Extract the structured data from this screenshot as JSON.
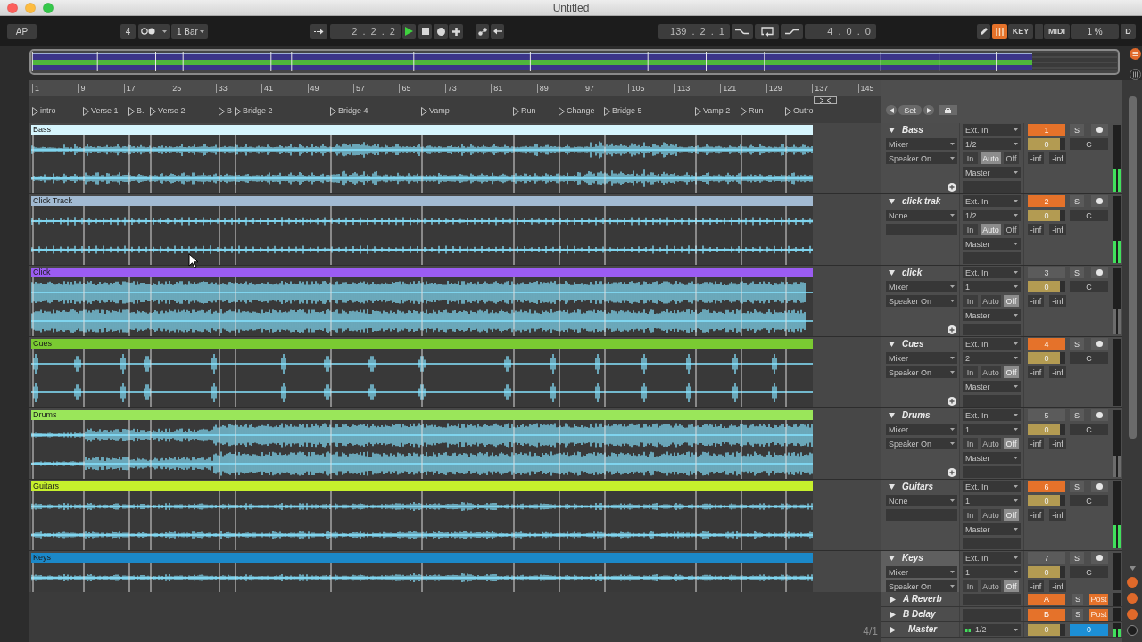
{
  "window": {
    "title": "Untitled"
  },
  "control_bar": {
    "tap": "AP",
    "signature": "4",
    "quantization": "1 Bar",
    "position": "2 . 2 . 2",
    "playing": true,
    "loop_start": "139 . 2 . 1",
    "loop_length": "4 . 0 . 0",
    "computer_keyboard": {
      "on": true
    },
    "key_map": "KEY",
    "midi_map": "MIDI",
    "cpu_load": "1 %",
    "disk_overload": "D"
  },
  "ruler": {
    "bars": [
      "1",
      "9",
      "17",
      "25",
      "33",
      "41",
      "49",
      "57",
      "65",
      "73",
      "81",
      "89",
      "97",
      "105",
      "113",
      "121",
      "129",
      "137",
      "145"
    ]
  },
  "locators": [
    "intro",
    "Verse 1",
    "B.",
    "Verse 2",
    "B",
    "Bridge 2",
    "Bridge 4",
    "Vamp",
    "Run",
    "Change",
    "Bridge 5",
    "Vamp 2",
    "Run",
    "Outro"
  ],
  "set_button": "Set",
  "tracks": [
    {
      "name": "Bass",
      "expanded": true,
      "selected": false,
      "clip": {
        "name": "Bass",
        "color": "#d6f5fd",
        "kind": "steady"
      },
      "routing": "Mixer",
      "routing_option": "Speaker On",
      "add_button": true,
      "input": "Ext. In",
      "input_channel": "1/2",
      "monitor": [
        {
          "label": "In",
          "selected": false
        },
        {
          "label": "Auto",
          "selected": true
        },
        {
          "label": "Off",
          "selected": false
        }
      ],
      "output": "Master",
      "number": "1",
      "active": true,
      "solo": "S",
      "volume": {
        "value": "0",
        "level": 0.85
      },
      "pan": "C",
      "peaks": [
        "-inf",
        "-inf"
      ],
      "meter": {
        "level": 0.33,
        "lit": true
      }
    },
    {
      "name": "click trak",
      "expanded": true,
      "selected": false,
      "clip": {
        "name": "Click Track",
        "color": "#a2bad2",
        "kind": "pulse"
      },
      "routing": "None",
      "add_button": false,
      "input": "Ext. In",
      "input_channel": "1/2",
      "monitor": [
        {
          "label": "In",
          "selected": false
        },
        {
          "label": "Auto",
          "selected": true
        },
        {
          "label": "Off",
          "selected": false
        }
      ],
      "output": "Master",
      "number": "2",
      "active": true,
      "solo": "S",
      "volume": {
        "value": "0",
        "level": 0.85
      },
      "pan": "C",
      "peaks": [
        "-inf",
        "-inf"
      ],
      "meter": {
        "level": 0.33,
        "lit": true
      }
    },
    {
      "name": "click",
      "expanded": true,
      "selected": false,
      "clip": {
        "name": "Click",
        "color": "#9b5cf2",
        "kind": "dense"
      },
      "routing": "Mixer",
      "routing_option": "Speaker On",
      "add_button": true,
      "input": "Ext. In",
      "input_channel": "1",
      "monitor": [
        {
          "label": "In",
          "selected": false
        },
        {
          "label": "Auto",
          "selected": false
        },
        {
          "label": "Off",
          "selected": true
        }
      ],
      "output": "Master",
      "number": "3",
      "active": false,
      "solo": "S",
      "volume": {
        "value": "0",
        "level": 0.85
      },
      "pan": "C",
      "peaks": [
        "-inf",
        "-inf"
      ],
      "meter": {
        "level": 0.38,
        "lit": false
      }
    },
    {
      "name": "Cues",
      "expanded": true,
      "selected": false,
      "clip": {
        "name": "Cues",
        "color": "#7aca32",
        "kind": "sparse"
      },
      "routing": "Mixer",
      "routing_option": "Speaker On",
      "add_button": true,
      "input": "Ext. In",
      "input_channel": "2",
      "monitor": [
        {
          "label": "In",
          "selected": false
        },
        {
          "label": "Auto",
          "selected": false
        },
        {
          "label": "Off",
          "selected": true
        }
      ],
      "output": "Master",
      "number": "4",
      "active": true,
      "solo": "S",
      "volume": {
        "value": "0",
        "level": 0.85
      },
      "pan": "C",
      "peaks": [
        "-inf",
        "-inf"
      ],
      "meter": {
        "level": 0
      }
    },
    {
      "name": "Drums",
      "expanded": true,
      "selected": false,
      "clip": {
        "name": "Drums",
        "color": "#9ae65a",
        "kind": "build"
      },
      "routing": "Mixer",
      "routing_option": "Speaker On",
      "add_button": true,
      "input": "Ext. In",
      "input_channel": "1",
      "monitor": [
        {
          "label": "In",
          "selected": false
        },
        {
          "label": "Auto",
          "selected": false
        },
        {
          "label": "Off",
          "selected": true
        }
      ],
      "output": "Master",
      "number": "5",
      "active": false,
      "solo": "S",
      "volume": {
        "value": "0",
        "level": 0.85
      },
      "pan": "C",
      "peaks": [
        "-inf",
        "-inf"
      ],
      "meter": {
        "level": 0.32,
        "lit": false
      }
    },
    {
      "name": "Guitars",
      "expanded": true,
      "selected": false,
      "clip": {
        "name": "Guitars",
        "color": "#c6f02c",
        "kind": "quiet"
      },
      "routing": "None",
      "add_button": false,
      "input": "Ext. In",
      "input_channel": "1",
      "monitor": [
        {
          "label": "In",
          "selected": false
        },
        {
          "label": "Auto",
          "selected": false
        },
        {
          "label": "Off",
          "selected": true
        }
      ],
      "output": "Master",
      "number": "6",
      "active": true,
      "solo": "S",
      "volume": {
        "value": "0",
        "level": 0.85
      },
      "pan": "C",
      "peaks": [
        "-inf",
        "-inf"
      ],
      "meter": {
        "level": 0.35,
        "lit": true
      }
    },
    {
      "name": "Keys",
      "expanded": true,
      "selected": true,
      "clip": {
        "name": "Keys",
        "color": "#1b88c8",
        "kind": "quiet"
      },
      "routing": "Mixer",
      "routing_option": "Speaker On",
      "input": "Ext. In",
      "input_channel": "1",
      "monitor": [
        {
          "label": "In",
          "selected": false
        },
        {
          "label": "Auto",
          "selected": false
        },
        {
          "label": "Off",
          "selected": true
        }
      ],
      "number": "7",
      "active": false,
      "solo": "S",
      "volume": {
        "value": "0",
        "level": 0.85
      },
      "pan": "C",
      "peaks": [
        "-inf",
        "-inf"
      ],
      "meter": {
        "level": 0
      }
    }
  ],
  "returns": [
    {
      "name": "A Reverb",
      "expanded": false,
      "letter": "A",
      "solo": "S",
      "send_mode": "Post"
    },
    {
      "name": "B Delay",
      "expanded": false,
      "letter": "B",
      "solo": "S",
      "send_mode": "Post"
    }
  ],
  "master": {
    "name": "Master",
    "expanded": false,
    "output_channel": "1/2",
    "volume": {
      "value": "0",
      "level": 0.85
    },
    "cue_volume": "0",
    "meter": {
      "level": 0.6,
      "lit": true
    }
  },
  "grid": "4/1"
}
